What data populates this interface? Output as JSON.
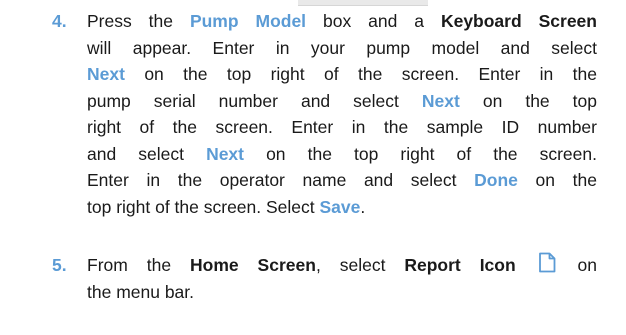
{
  "steps": [
    {
      "number": "4.",
      "lines": [
        [
          {
            "t": "Press the "
          },
          {
            "t": "Pump Model",
            "s": "hl"
          },
          {
            "t": " box and a "
          },
          {
            "t": "Keyboard Screen",
            "s": "b"
          }
        ],
        [
          {
            "t": "will appear. Enter in your pump model and select"
          }
        ],
        [
          {
            "t": "Next",
            "s": "hl"
          },
          {
            "t": " on the top right of the screen. Enter in the"
          }
        ],
        [
          {
            "t": "pump serial number and select "
          },
          {
            "t": "Next",
            "s": "hl"
          },
          {
            "t": " on the top"
          }
        ],
        [
          {
            "t": "right of the screen.  Enter in the sample ID number"
          }
        ],
        [
          {
            "t": "and select "
          },
          {
            "t": "Next",
            "s": "hl"
          },
          {
            "t": " on the top right of the screen."
          }
        ],
        [
          {
            "t": "Enter in the operator name and select "
          },
          {
            "t": "Done",
            "s": "hl"
          },
          {
            "t": " on the"
          }
        ],
        [
          {
            "t": "top right of the screen. Select "
          },
          {
            "t": "Save",
            "s": "hl"
          },
          {
            "t": "."
          }
        ]
      ]
    },
    {
      "number": "5.",
      "lines": [
        [
          {
            "t": "From the "
          },
          {
            "t": "Home Screen",
            "s": "b"
          },
          {
            "t": ", select "
          },
          {
            "t": "Report Icon",
            "s": "b"
          },
          {
            "t": " "
          },
          {
            "icon": "report-document-icon"
          },
          {
            "t": " on"
          }
        ],
        [
          {
            "t": "the menu bar."
          }
        ]
      ]
    }
  ],
  "colors": {
    "accent": "#5b9bd5",
    "text": "#1a1a1a"
  },
  "icons": {
    "report_icon": "report-document-icon"
  }
}
